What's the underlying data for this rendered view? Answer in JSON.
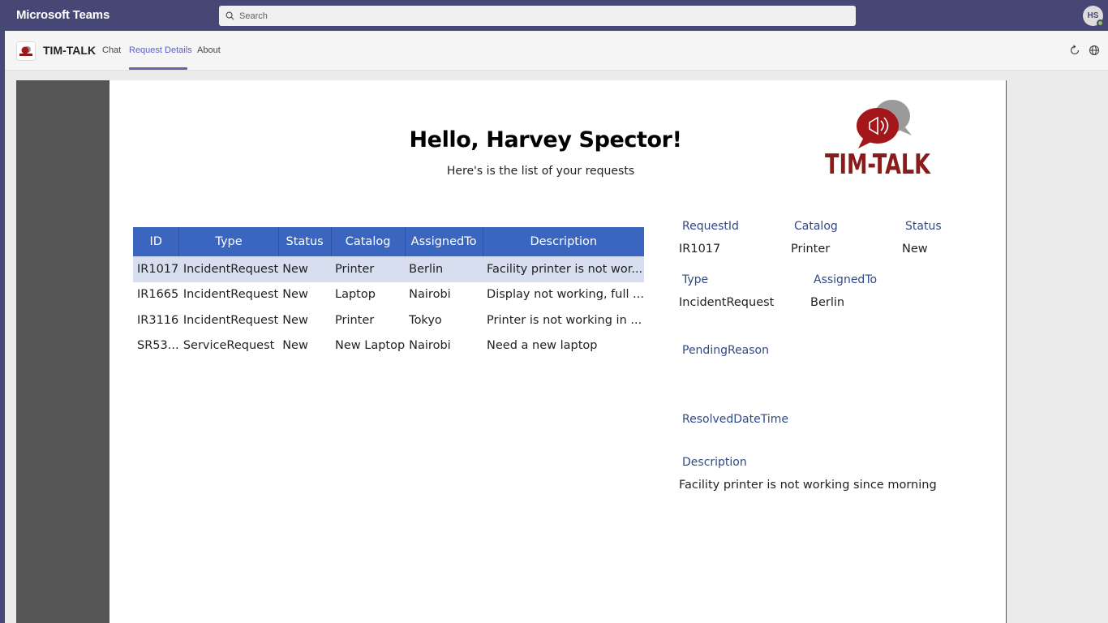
{
  "app": {
    "name": "Microsoft Teams",
    "search_placeholder": "Search",
    "user_initials": "HS"
  },
  "appbar": {
    "title": "TIM-TALK",
    "tabs": [
      {
        "label": "Chat",
        "active": false
      },
      {
        "label": "Request Details",
        "active": true
      },
      {
        "label": "About",
        "active": false
      }
    ],
    "icons": [
      "refresh-icon",
      "globe-icon"
    ]
  },
  "page": {
    "greeting": "Hello, Harvey Spector!",
    "subtitle": "Here's is the list of your requests",
    "logo_text": "TIM-TALK"
  },
  "table": {
    "headers": [
      "ID",
      "Type",
      "Status",
      "Catalog",
      "AssignedTo",
      "Description"
    ],
    "rows": [
      [
        "IR1017",
        "IncidentRequest",
        "New",
        "Printer",
        "Berlin",
        "Facility printer is not wor..."
      ],
      [
        "IR1665",
        "IncidentRequest",
        "New",
        "Laptop",
        "Nairobi",
        "Display not working, full ..."
      ],
      [
        "IR3116",
        "IncidentRequest",
        "New",
        "Printer",
        "Tokyo",
        "Printer is not working in ..."
      ],
      [
        "SR53...",
        "ServiceRequest",
        "New",
        "New Laptop",
        "Nairobi",
        "Need a new laptop"
      ]
    ],
    "selected_row": 0
  },
  "details": {
    "request_id_label": "RequestId",
    "request_id": "IR1017",
    "catalog_label": "Catalog",
    "catalog": "Printer",
    "status_label": "Status",
    "status": "New",
    "type_label": "Type",
    "type": "IncidentRequest",
    "assigned_label": "AssignedTo",
    "assigned": "Berlin",
    "pending_label": "PendingReason",
    "resolved_label": "ResolvedDateTime",
    "description_label": "Description",
    "description": "Facility printer is not working since morning"
  },
  "colors": {
    "teams_header": "#464775",
    "accent": "#6264a7",
    "table_header": "#3a66c0",
    "selected_row": "#d6def0",
    "label_blue": "#2f4a86",
    "logo_red": "#8b1a1a"
  }
}
